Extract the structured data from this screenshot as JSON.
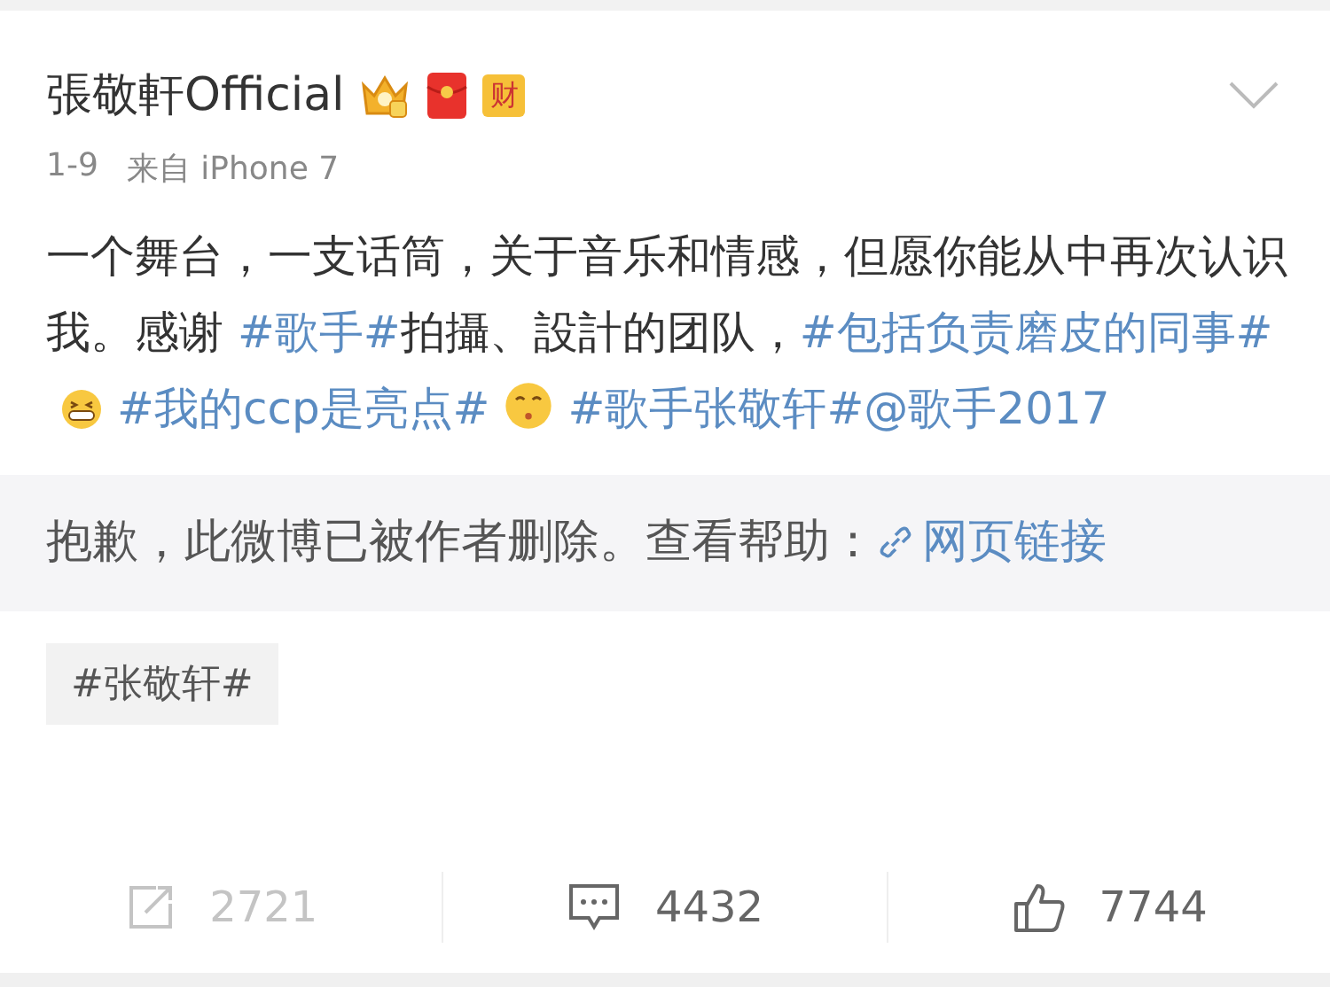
{
  "post": {
    "author": "張敬軒Official",
    "badges": [
      {
        "kind": "crown"
      },
      {
        "kind": "envelope"
      },
      {
        "kind": "label",
        "text": "财"
      }
    ],
    "date": "1-9",
    "source": "来自 iPhone 7",
    "body": [
      {
        "kind": "text",
        "text": "一个舞台，一支话筒，关于音乐和情感，但愿你能从中再次认识我。感谢 "
      },
      {
        "kind": "topic",
        "text": "#歌手#"
      },
      {
        "kind": "text",
        "text": "拍攝、設計的团队，"
      },
      {
        "kind": "topic",
        "text": "#包括负责磨皮的同事#"
      },
      {
        "kind": "grin"
      },
      {
        "kind": "topic",
        "text": "#我的ccp是亮点#"
      },
      {
        "kind": "kiss"
      },
      {
        "kind": "topic",
        "text": "#歌手张敬轩#"
      },
      {
        "kind": "topic",
        "text": "@歌手2017"
      }
    ],
    "repost": {
      "notice": "抱歉，此微博已被作者删除。查看帮助：",
      "link": "网页链接"
    },
    "tag": "#张敬轩#",
    "actions": [
      {
        "kind": "share",
        "count": "2721",
        "disabled": true
      },
      {
        "kind": "comment",
        "count": "4432",
        "disabled": false
      },
      {
        "kind": "like",
        "count": "7744",
        "disabled": false
      }
    ]
  }
}
